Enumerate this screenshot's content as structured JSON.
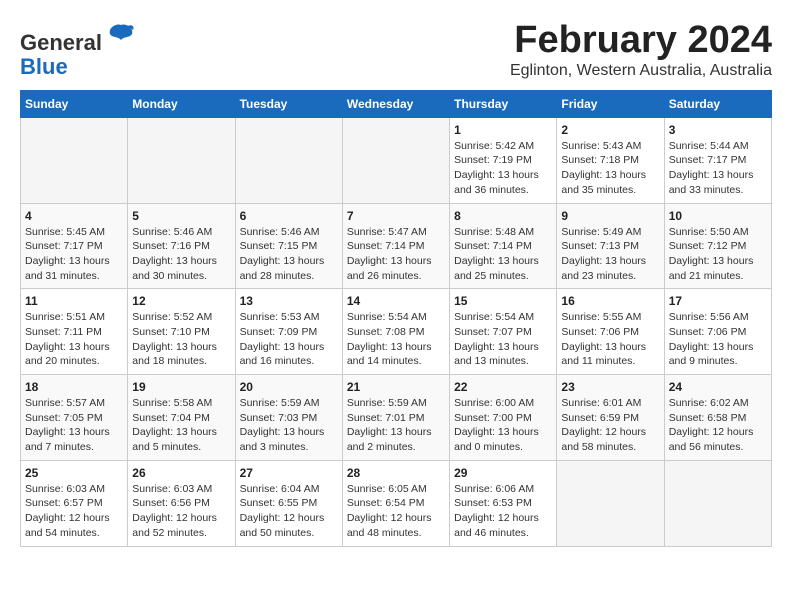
{
  "header": {
    "logo_line1": "General",
    "logo_line2": "Blue",
    "title": "February 2024",
    "subtitle": "Eglinton, Western Australia, Australia"
  },
  "calendar": {
    "days_of_week": [
      "Sunday",
      "Monday",
      "Tuesday",
      "Wednesday",
      "Thursday",
      "Friday",
      "Saturday"
    ],
    "weeks": [
      [
        {
          "day": "",
          "info": ""
        },
        {
          "day": "",
          "info": ""
        },
        {
          "day": "",
          "info": ""
        },
        {
          "day": "",
          "info": ""
        },
        {
          "day": "1",
          "info": "Sunrise: 5:42 AM\nSunset: 7:19 PM\nDaylight: 13 hours\nand 36 minutes."
        },
        {
          "day": "2",
          "info": "Sunrise: 5:43 AM\nSunset: 7:18 PM\nDaylight: 13 hours\nand 35 minutes."
        },
        {
          "day": "3",
          "info": "Sunrise: 5:44 AM\nSunset: 7:17 PM\nDaylight: 13 hours\nand 33 minutes."
        }
      ],
      [
        {
          "day": "4",
          "info": "Sunrise: 5:45 AM\nSunset: 7:17 PM\nDaylight: 13 hours\nand 31 minutes."
        },
        {
          "day": "5",
          "info": "Sunrise: 5:46 AM\nSunset: 7:16 PM\nDaylight: 13 hours\nand 30 minutes."
        },
        {
          "day": "6",
          "info": "Sunrise: 5:46 AM\nSunset: 7:15 PM\nDaylight: 13 hours\nand 28 minutes."
        },
        {
          "day": "7",
          "info": "Sunrise: 5:47 AM\nSunset: 7:14 PM\nDaylight: 13 hours\nand 26 minutes."
        },
        {
          "day": "8",
          "info": "Sunrise: 5:48 AM\nSunset: 7:14 PM\nDaylight: 13 hours\nand 25 minutes."
        },
        {
          "day": "9",
          "info": "Sunrise: 5:49 AM\nSunset: 7:13 PM\nDaylight: 13 hours\nand 23 minutes."
        },
        {
          "day": "10",
          "info": "Sunrise: 5:50 AM\nSunset: 7:12 PM\nDaylight: 13 hours\nand 21 minutes."
        }
      ],
      [
        {
          "day": "11",
          "info": "Sunrise: 5:51 AM\nSunset: 7:11 PM\nDaylight: 13 hours\nand 20 minutes."
        },
        {
          "day": "12",
          "info": "Sunrise: 5:52 AM\nSunset: 7:10 PM\nDaylight: 13 hours\nand 18 minutes."
        },
        {
          "day": "13",
          "info": "Sunrise: 5:53 AM\nSunset: 7:09 PM\nDaylight: 13 hours\nand 16 minutes."
        },
        {
          "day": "14",
          "info": "Sunrise: 5:54 AM\nSunset: 7:08 PM\nDaylight: 13 hours\nand 14 minutes."
        },
        {
          "day": "15",
          "info": "Sunrise: 5:54 AM\nSunset: 7:07 PM\nDaylight: 13 hours\nand 13 minutes."
        },
        {
          "day": "16",
          "info": "Sunrise: 5:55 AM\nSunset: 7:06 PM\nDaylight: 13 hours\nand 11 minutes."
        },
        {
          "day": "17",
          "info": "Sunrise: 5:56 AM\nSunset: 7:06 PM\nDaylight: 13 hours\nand 9 minutes."
        }
      ],
      [
        {
          "day": "18",
          "info": "Sunrise: 5:57 AM\nSunset: 7:05 PM\nDaylight: 13 hours\nand 7 minutes."
        },
        {
          "day": "19",
          "info": "Sunrise: 5:58 AM\nSunset: 7:04 PM\nDaylight: 13 hours\nand 5 minutes."
        },
        {
          "day": "20",
          "info": "Sunrise: 5:59 AM\nSunset: 7:03 PM\nDaylight: 13 hours\nand 3 minutes."
        },
        {
          "day": "21",
          "info": "Sunrise: 5:59 AM\nSunset: 7:01 PM\nDaylight: 13 hours\nand 2 minutes."
        },
        {
          "day": "22",
          "info": "Sunrise: 6:00 AM\nSunset: 7:00 PM\nDaylight: 13 hours\nand 0 minutes."
        },
        {
          "day": "23",
          "info": "Sunrise: 6:01 AM\nSunset: 6:59 PM\nDaylight: 12 hours\nand 58 minutes."
        },
        {
          "day": "24",
          "info": "Sunrise: 6:02 AM\nSunset: 6:58 PM\nDaylight: 12 hours\nand 56 minutes."
        }
      ],
      [
        {
          "day": "25",
          "info": "Sunrise: 6:03 AM\nSunset: 6:57 PM\nDaylight: 12 hours\nand 54 minutes."
        },
        {
          "day": "26",
          "info": "Sunrise: 6:03 AM\nSunset: 6:56 PM\nDaylight: 12 hours\nand 52 minutes."
        },
        {
          "day": "27",
          "info": "Sunrise: 6:04 AM\nSunset: 6:55 PM\nDaylight: 12 hours\nand 50 minutes."
        },
        {
          "day": "28",
          "info": "Sunrise: 6:05 AM\nSunset: 6:54 PM\nDaylight: 12 hours\nand 48 minutes."
        },
        {
          "day": "29",
          "info": "Sunrise: 6:06 AM\nSunset: 6:53 PM\nDaylight: 12 hours\nand 46 minutes."
        },
        {
          "day": "",
          "info": ""
        },
        {
          "day": "",
          "info": ""
        }
      ]
    ]
  }
}
